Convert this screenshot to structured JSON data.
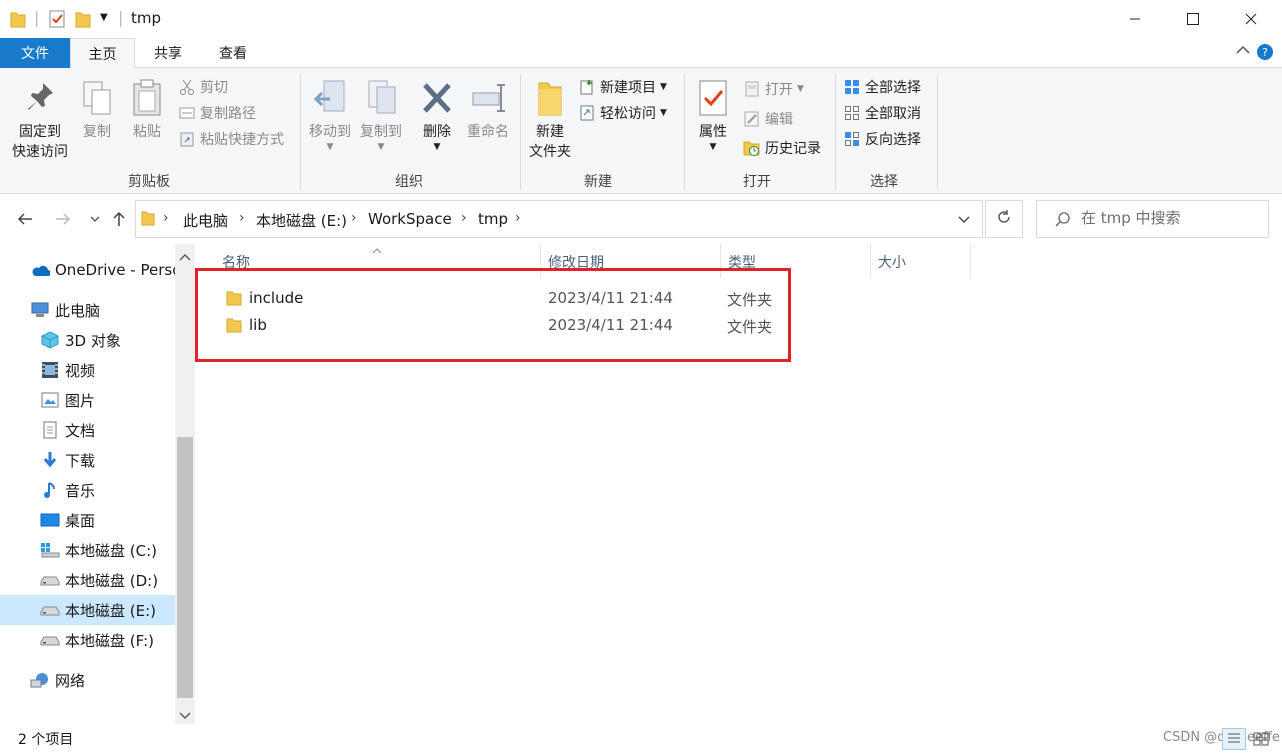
{
  "window": {
    "title": "tmp"
  },
  "ribbon_tabs": {
    "file": "文件",
    "home": "主页",
    "share": "共享",
    "view": "查看"
  },
  "ribbon": {
    "clipboard": {
      "label": "剪贴板",
      "pin_line1": "固定到",
      "pin_line2": "快速访问",
      "copy": "复制",
      "paste": "粘贴",
      "cut": "剪切",
      "copy_path": "复制路径",
      "paste_shortcut": "粘贴快捷方式"
    },
    "organize": {
      "label": "组织",
      "move_to": "移动到",
      "copy_to": "复制到",
      "delete": "删除",
      "rename": "重命名"
    },
    "new": {
      "label": "新建",
      "new_folder_line1": "新建",
      "new_folder_line2": "文件夹",
      "new_item": "新建项目",
      "easy_access": "轻松访问"
    },
    "open": {
      "label": "打开",
      "properties": "属性",
      "open": "打开",
      "edit": "编辑",
      "history": "历史记录"
    },
    "select": {
      "label": "选择",
      "select_all": "全部选择",
      "select_none": "全部取消",
      "invert": "反向选择"
    }
  },
  "address": {
    "crumbs": [
      "此电脑",
      "本地磁盘 (E:)",
      "WorkSpace",
      "tmp"
    ]
  },
  "search": {
    "placeholder": "在 tmp 中搜索"
  },
  "nav_pane": {
    "items": [
      {
        "label": "OneDrive - Perso",
        "icon": "onedrive-cloud-icon"
      },
      {
        "label": "此电脑",
        "icon": "this-pc-icon"
      },
      {
        "label": "3D 对象",
        "icon": "3d-objects-icon"
      },
      {
        "label": "视频",
        "icon": "video-icon"
      },
      {
        "label": "图片",
        "icon": "pictures-icon"
      },
      {
        "label": "文档",
        "icon": "documents-icon"
      },
      {
        "label": "下载",
        "icon": "download-icon"
      },
      {
        "label": "音乐",
        "icon": "music-icon"
      },
      {
        "label": "桌面",
        "icon": "desktop-icon"
      },
      {
        "label": "本地磁盘 (C:)",
        "icon": "windows-drive-icon"
      },
      {
        "label": "本地磁盘 (D:)",
        "icon": "drive-icon"
      },
      {
        "label": "本地磁盘 (E:)",
        "icon": "drive-icon",
        "selected": true
      },
      {
        "label": "本地磁盘 (F:)",
        "icon": "drive-icon"
      },
      {
        "label": "网络",
        "icon": "network-icon"
      }
    ]
  },
  "file_list": {
    "columns": [
      "名称",
      "修改日期",
      "类型",
      "大小"
    ],
    "rows": [
      {
        "name": "include",
        "modified": "2023/4/11 21:44",
        "type": "文件夹",
        "size": ""
      },
      {
        "name": "lib",
        "modified": "2023/4/11 21:44",
        "type": "文件夹",
        "size": ""
      }
    ]
  },
  "status": {
    "item_count": "2 个项目",
    "watermark": "CSDN @qasseeffe"
  },
  "colors": {
    "accent": "#1979ca",
    "highlight_box": "#e0232a",
    "selected_bg": "#cce8ff",
    "folder": "#f2c94c"
  }
}
